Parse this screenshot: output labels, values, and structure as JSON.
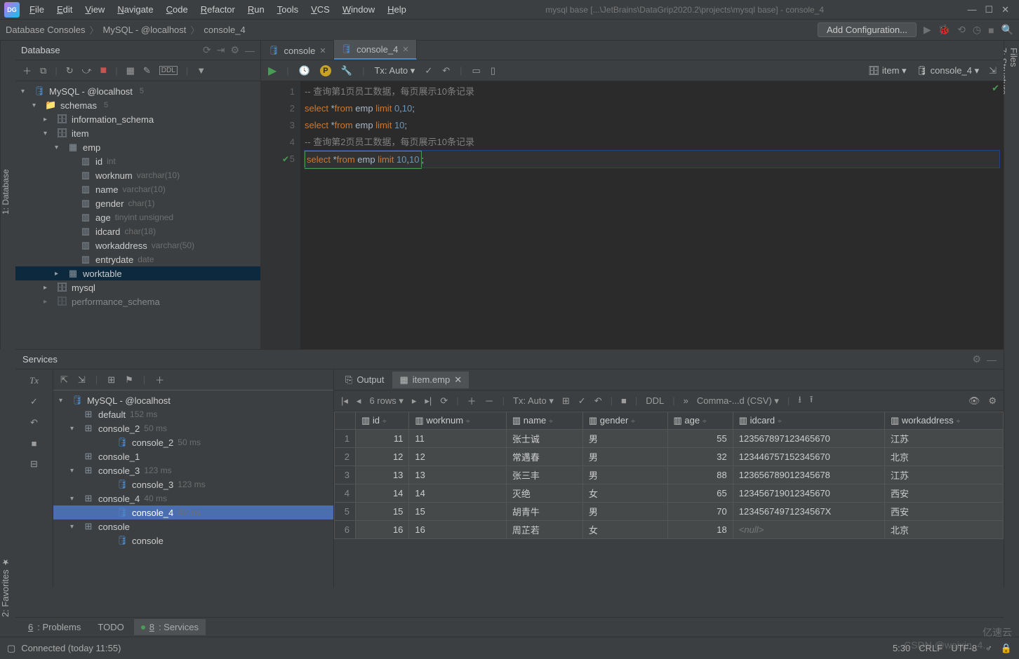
{
  "window": {
    "title": "mysql base [...\\JetBrains\\DataGrip2020.2\\projects\\mysql base] - console_4"
  },
  "menu": [
    "File",
    "Edit",
    "View",
    "Navigate",
    "Code",
    "Refactor",
    "Run",
    "Tools",
    "VCS",
    "Window",
    "Help"
  ],
  "breadcrumb": [
    "Database Consoles",
    "MySQL - @localhost",
    "console_4"
  ],
  "config_button": "Add Configuration...",
  "db_panel": {
    "title": "Database",
    "root": {
      "label": "MySQL - @localhost",
      "badge": "5"
    },
    "schemas_label": "schemas",
    "schemas_count": "5",
    "info_schema": "information_schema",
    "item": "item",
    "emp": "emp",
    "columns": [
      {
        "name": "id",
        "type": "int"
      },
      {
        "name": "worknum",
        "type": "varchar(10)"
      },
      {
        "name": "name",
        "type": "varchar(10)"
      },
      {
        "name": "gender",
        "type": "char(1)"
      },
      {
        "name": "age",
        "type": "tinyint unsigned"
      },
      {
        "name": "idcard",
        "type": "char(18)"
      },
      {
        "name": "workaddress",
        "type": "varchar(50)"
      },
      {
        "name": "entrydate",
        "type": "date"
      }
    ],
    "worktable": "worktable",
    "mysql": "mysql",
    "perf": "performance_schema"
  },
  "tabs": [
    {
      "label": "console",
      "active": false
    },
    {
      "label": "console_4",
      "active": true
    }
  ],
  "editor_toolbar": {
    "tx": "Tx: Auto",
    "schema": "item",
    "console": "console_4"
  },
  "code": [
    {
      "n": "1",
      "type": "comment",
      "text": "-- 查询第1页员工数据，每页展示10条记录"
    },
    {
      "n": "2",
      "type": "sql",
      "s": "select",
      "star": "*",
      "f": "from",
      "t": "emp",
      "l": "limit",
      "args": "0,10"
    },
    {
      "n": "3",
      "type": "sql",
      "s": "select",
      "star": "*",
      "f": "from",
      "t": "emp",
      "l": "limit",
      "args": "10"
    },
    {
      "n": "4",
      "type": "comment",
      "text": "-- 查询第2页员工数据，每页展示10条记录"
    },
    {
      "n": "5",
      "type": "sql",
      "s": "select",
      "star": "*",
      "f": "from",
      "t": "emp",
      "l": "limit",
      "args": "10,10",
      "hl": true
    }
  ],
  "services": {
    "title": "Services",
    "root": "MySQL - @localhost",
    "items": [
      {
        "label": "default",
        "time": "152 ms",
        "lvl": 1,
        "ic": "svc"
      },
      {
        "label": "console_2",
        "time": "50 ms",
        "lvl": 1,
        "ic": "svc",
        "arr": "v"
      },
      {
        "label": "console_2",
        "time": "50 ms",
        "lvl": 2,
        "ic": "q"
      },
      {
        "label": "console_1",
        "time": "",
        "lvl": 1,
        "ic": "svc"
      },
      {
        "label": "console_3",
        "time": "123 ms",
        "lvl": 1,
        "ic": "svc",
        "arr": "v"
      },
      {
        "label": "console_3",
        "time": "123 ms",
        "lvl": 2,
        "ic": "q"
      },
      {
        "label": "console_4",
        "time": "40 ms",
        "lvl": 1,
        "ic": "svc",
        "arr": "v"
      },
      {
        "label": "console_4",
        "time": "40 ms",
        "lvl": 2,
        "ic": "q",
        "sel": true
      },
      {
        "label": "console",
        "time": "",
        "lvl": 1,
        "ic": "svc",
        "arr": "v"
      },
      {
        "label": "console",
        "time": "",
        "lvl": 2,
        "ic": "q"
      }
    ]
  },
  "output_tabs": [
    {
      "label": "Output"
    },
    {
      "label": "item.emp",
      "active": true
    }
  ],
  "grid_toolbar": {
    "rows": "6 rows",
    "tx": "Tx: Auto",
    "ddl": "DDL",
    "export": "Comma-...d (CSV)"
  },
  "grid": {
    "columns": [
      "id",
      "worknum",
      "name",
      "gender",
      "age",
      "idcard",
      "workaddress"
    ],
    "rows": [
      {
        "n": "1",
        "id": "11",
        "worknum": "11",
        "name": "张士诚",
        "gender": "男",
        "age": "55",
        "idcard": "123567897123465670",
        "workaddress": "江苏"
      },
      {
        "n": "2",
        "id": "12",
        "worknum": "12",
        "name": "常遇春",
        "gender": "男",
        "age": "32",
        "idcard": "123446757152345670",
        "workaddress": "北京"
      },
      {
        "n": "3",
        "id": "13",
        "worknum": "13",
        "name": "张三丰",
        "gender": "男",
        "age": "88",
        "idcard": "123656789012345678",
        "workaddress": "江苏"
      },
      {
        "n": "4",
        "id": "14",
        "worknum": "14",
        "name": "灭绝",
        "gender": "女",
        "age": "65",
        "idcard": "123456719012345670",
        "workaddress": "西安"
      },
      {
        "n": "5",
        "id": "15",
        "worknum": "15",
        "name": "胡青牛",
        "gender": "男",
        "age": "70",
        "idcard": "12345674971234567X",
        "workaddress": "西安"
      },
      {
        "n": "6",
        "id": "16",
        "worknum": "16",
        "name": "周芷若",
        "gender": "女",
        "age": "18",
        "idcard": "<null>",
        "workaddress": "北京"
      }
    ]
  },
  "bottom_tabs": [
    {
      "label": "6: Problems",
      "u": "6"
    },
    {
      "label": "TODO"
    },
    {
      "label": "8: Services",
      "u": "8",
      "active": true
    }
  ],
  "status": {
    "msg": "Connected (today 11:55)",
    "pos": "5:30",
    "crlf": "CRLF",
    "enc": "UTF-8"
  },
  "left_gutter": "1: Database",
  "right_gutter_top": "Files",
  "right_gutter_bottom": "7: Structure",
  "left_fav": "2: Favorites",
  "watermark": "亿速云",
  "watermark2": "CSDN @weixin_4..."
}
